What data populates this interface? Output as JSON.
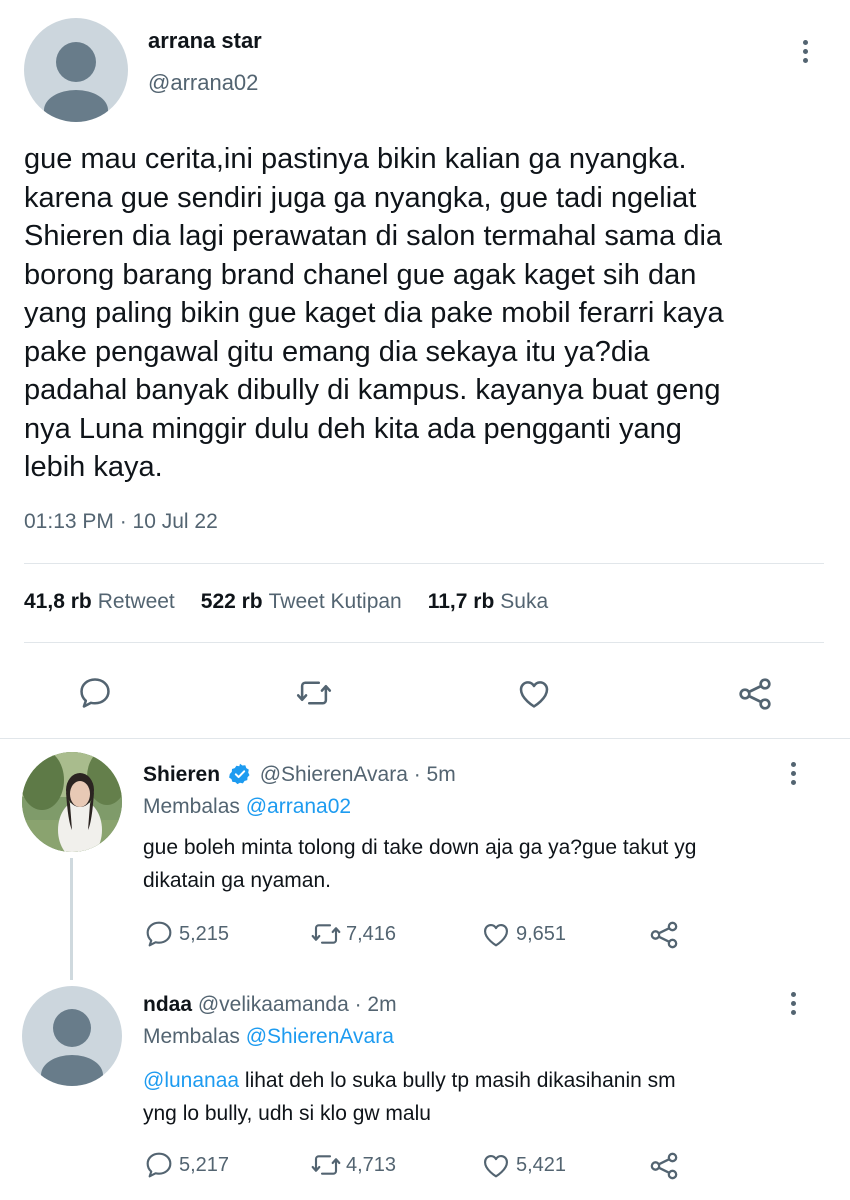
{
  "main_tweet": {
    "name": "arrana star",
    "handle": "@arrana02",
    "text": "gue mau cerita,ini pastinya bikin kalian ga nyangka.\nkarena gue sendiri juga ga nyangka, gue tadi ngeliat\nShieren dia lagi perawatan di salon termahal sama dia\nborong barang brand chanel gue agak kaget sih dan\nyang paling bikin gue kaget dia pake mobil ferarri kaya\npake pengawal gitu emang dia sekaya itu ya?dia\npadahal banyak dibully di kampus. kayanya buat geng\nnya Luna minggir dulu deh kita ada pengganti yang\nlebih kaya.",
    "timestamp": "01:13 PM · 10 Jul 22",
    "stats": {
      "retweets_count": "41,8 rb",
      "retweets_label": "Retweet",
      "quotes_count": "522 rb",
      "quotes_label": "Tweet Kutipan",
      "likes_count": "11,7 rb",
      "likes_label": "Suka"
    },
    "actions": [
      "reply-icon",
      "retweet-icon",
      "like-icon",
      "share-icon"
    ]
  },
  "replies": [
    {
      "name": "Shieren",
      "verified": true,
      "handle": "@ShierenAvara · 5m",
      "replying_label": "Membalas",
      "replying_to": "@arrana02",
      "text": "gue boleh minta tolong di take down aja ga ya?gue takut yg\ndikatain ga nyaman.",
      "counts": {
        "replies": "5,215",
        "retweets": "7,416",
        "likes": "9,651"
      }
    },
    {
      "name": "ndaa",
      "verified": false,
      "handle": "@velikaamanda · 2m",
      "replying_label": "Membalas",
      "replying_to": "@ShierenAvara",
      "mention": "@lunanaa",
      "text": " lihat deh lo suka bully tp masih dikasihanin sm\nyng lo bully, udh si klo gw malu",
      "counts": {
        "replies": "5,217",
        "retweets": "4,713",
        "likes": "5,421"
      }
    }
  ],
  "colors": {
    "accent": "#1d9bf0",
    "muted": "#536471",
    "text": "#0f1419"
  }
}
